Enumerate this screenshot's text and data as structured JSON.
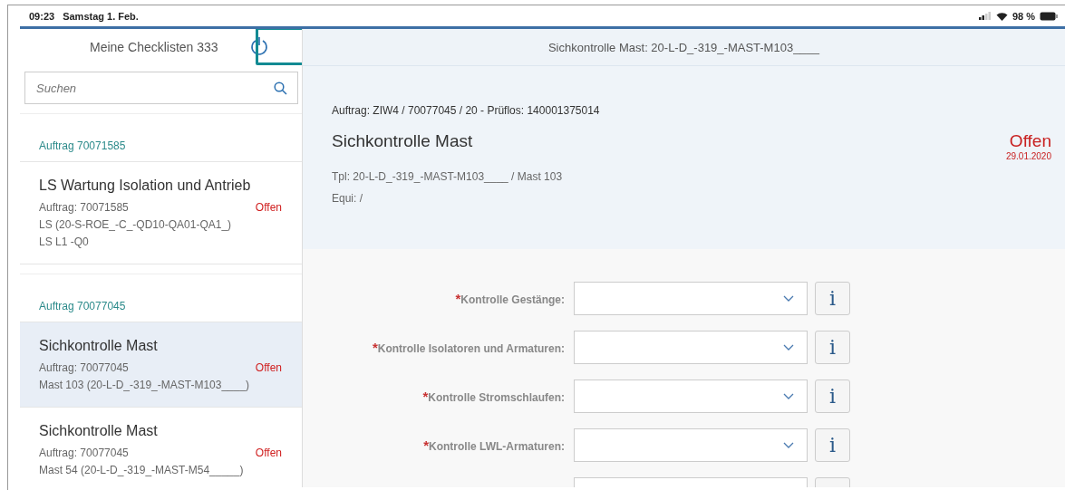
{
  "status_bar": {
    "time": "09:23",
    "date": "Samstag 1. Feb.",
    "battery": "98 %"
  },
  "sidebar": {
    "title": "Meine Checklisten 333",
    "search": {
      "placeholder": "Suchen"
    },
    "groups": [
      {
        "header": "Auftrag 70071585",
        "items": [
          {
            "title": "LS Wartung Isolation und Antrieb",
            "order": "Auftrag: 70071585",
            "status": "Offen",
            "lines": [
              "LS (20-S-ROE_-C_-QD10-QA01-QA1_)",
              "LS L1 -Q0"
            ],
            "selected": false
          }
        ]
      },
      {
        "header": "Auftrag 70077045",
        "items": [
          {
            "title": "Sichkontrolle Mast",
            "order": "Auftrag: 70077045",
            "status": "Offen",
            "lines": [
              "Mast 103 (20-L-D_-319_-MAST-M103____)"
            ],
            "selected": true
          },
          {
            "title": "Sichkontrolle Mast",
            "order": "Auftrag: 70077045",
            "status": "Offen",
            "lines": [
              "Mast 54 (20-L-D_-319_-MAST-M54_____)"
            ],
            "selected": false
          }
        ]
      }
    ]
  },
  "detail": {
    "title": "Sichkontrolle Mast: 20-L-D_-319_-MAST-M103____",
    "order_line": "Auftrag: ZIW4 / 70077045 / 20 - Prüflos: 140001375014",
    "heading": "Sichkontrolle Mast",
    "status": "Offen",
    "status_date": "29.01.2020",
    "tpl": "Tpl: 20-L-D_-319_-MAST-M103____ / Mast 103",
    "equi": "Equi:  /"
  },
  "form": {
    "fields": [
      {
        "label": "Kontrolle Gestänge:",
        "required_mark": "*",
        "info": "i"
      },
      {
        "label": "Kontrolle Isolatoren und Armaturen:",
        "required_mark": "*",
        "info": "i"
      },
      {
        "label": "Kontrolle Stromschlaufen:",
        "required_mark": "*",
        "info": "i"
      },
      {
        "label": "Kontrolle LWL-Armaturen:",
        "required_mark": "*",
        "info": "i"
      }
    ]
  }
}
